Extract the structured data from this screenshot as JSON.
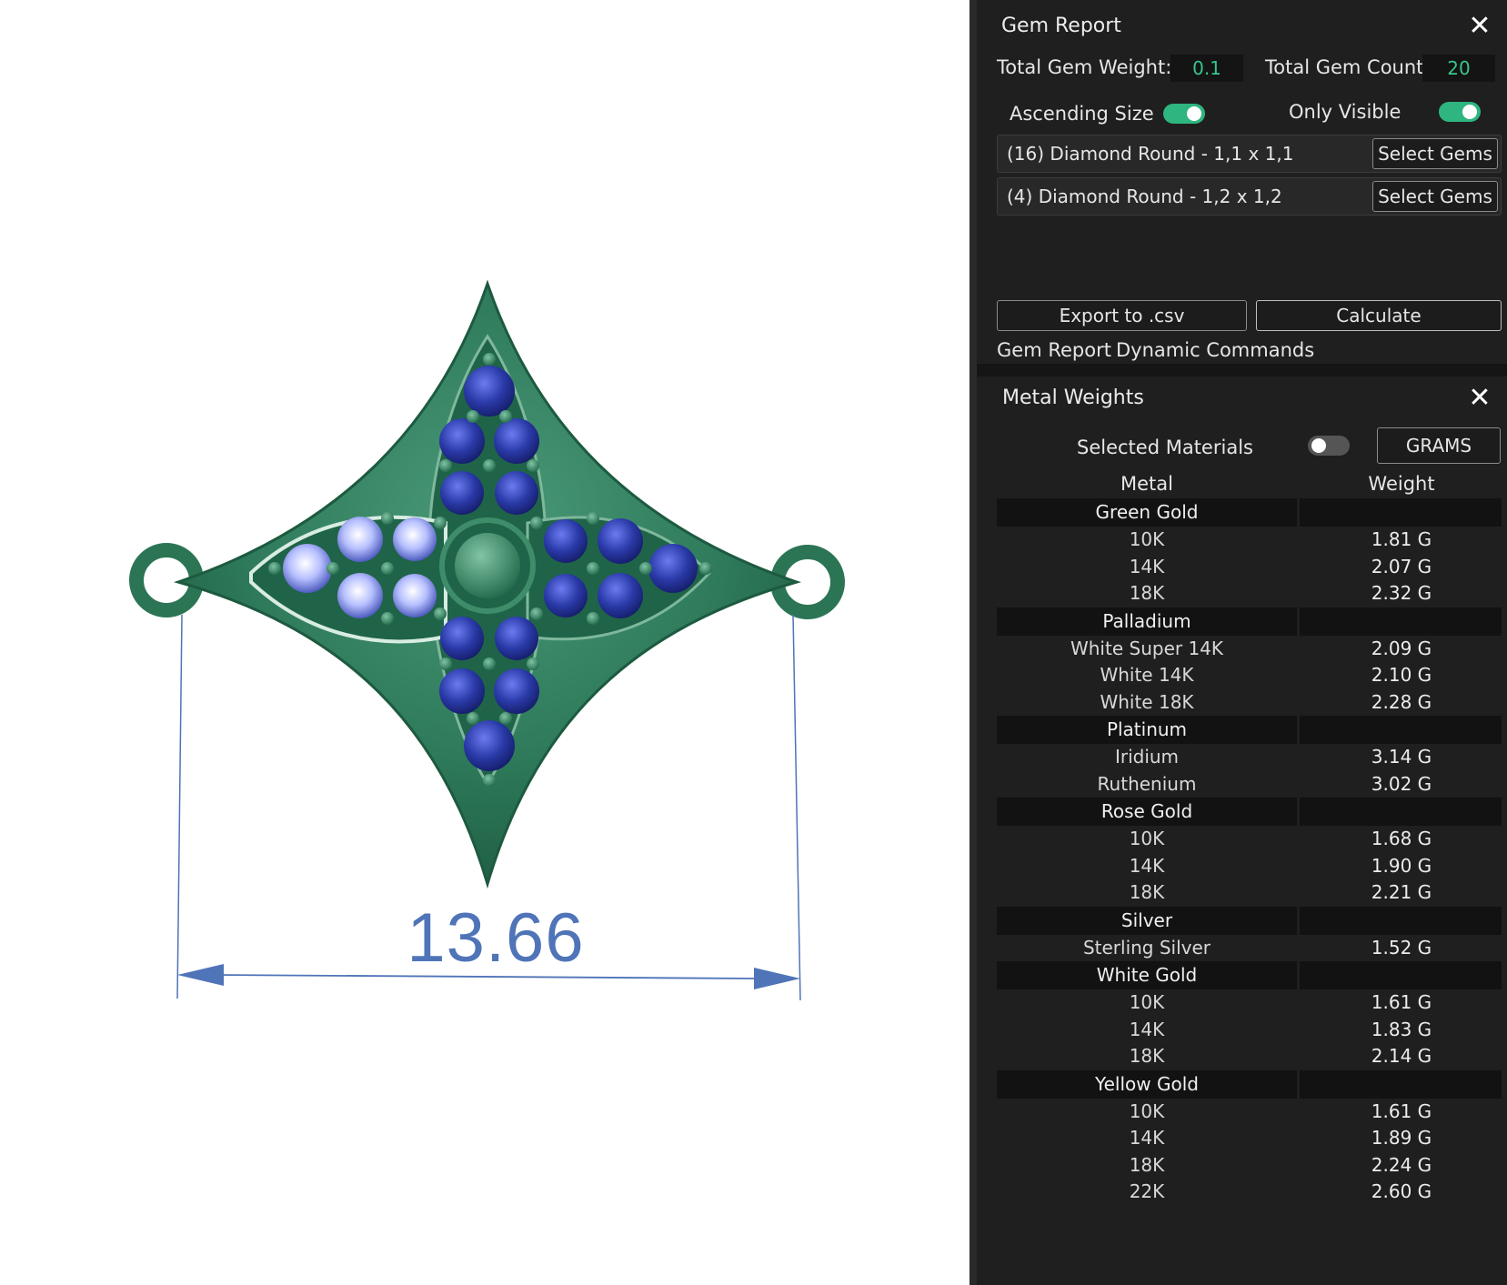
{
  "viewport": {
    "dimension_value": "13.66",
    "colors": {
      "metal": "#2e7a5a",
      "gems": "#2a3aa8",
      "dimension": "#4f74b8"
    }
  },
  "gem_report": {
    "title": "Gem Report",
    "total_weight_label": "Total Gem Weight:",
    "total_weight_value": "0.1",
    "total_count_label": "Total Gem Count:",
    "total_count_value": "20",
    "ascending_label": "Ascending Size",
    "ascending_on": true,
    "only_visible_label": "Only Visible",
    "only_visible_on": true,
    "gems": [
      {
        "text": "(16) Diamond Round - 1,1 x 1,1",
        "button": "Select Gems"
      },
      {
        "text": "(4) Diamond Round - 1,2 x 1,2",
        "button": "Select Gems"
      }
    ],
    "export_label": "Export to .csv",
    "calculate_label": "Calculate"
  },
  "tabs": [
    "Gem Report",
    "Dynamic Commands"
  ],
  "metal_weights": {
    "title": "Metal Weights",
    "selected_materials_label": "Selected Materials",
    "selected_materials_on": false,
    "unit_button": "GRAMS",
    "col_metal": "Metal",
    "col_weight": "Weight",
    "groups": [
      {
        "name": "Green Gold",
        "items": [
          [
            "10K",
            "1.81 G"
          ],
          [
            "14K",
            "2.07 G"
          ],
          [
            "18K",
            "2.32 G"
          ]
        ]
      },
      {
        "name": "Palladium",
        "items": [
          [
            "White Super 14K",
            "2.09 G"
          ],
          [
            "White 14K",
            "2.10 G"
          ],
          [
            "White 18K",
            "2.28 G"
          ]
        ]
      },
      {
        "name": "Platinum",
        "items": [
          [
            "Iridium",
            "3.14 G"
          ],
          [
            "Ruthenium",
            "3.02 G"
          ]
        ]
      },
      {
        "name": "Rose Gold",
        "items": [
          [
            "10K",
            "1.68 G"
          ],
          [
            "14K",
            "1.90 G"
          ],
          [
            "18K",
            "2.21 G"
          ]
        ]
      },
      {
        "name": "Silver",
        "items": [
          [
            "Sterling Silver",
            "1.52 G"
          ]
        ]
      },
      {
        "name": "White Gold",
        "items": [
          [
            "10K",
            "1.61 G"
          ],
          [
            "14K",
            "1.83 G"
          ],
          [
            "18K",
            "2.14 G"
          ]
        ]
      },
      {
        "name": "Yellow Gold",
        "items": [
          [
            "10K",
            "1.61 G"
          ],
          [
            "14K",
            "1.89 G"
          ],
          [
            "18K",
            "2.24 G"
          ],
          [
            "22K",
            "2.60 G"
          ]
        ]
      }
    ]
  }
}
